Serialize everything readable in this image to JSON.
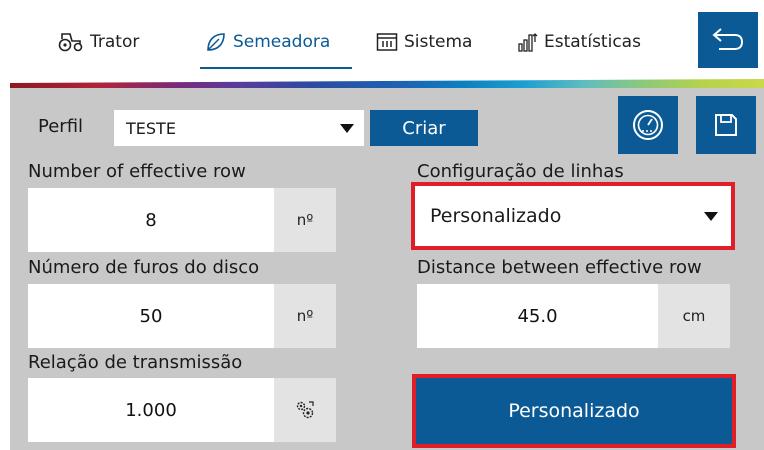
{
  "nav": {
    "tabs": [
      {
        "label": "Trator",
        "icon": "tractor-icon"
      },
      {
        "label": "Semeadora",
        "icon": "leaf-icon",
        "active": true
      },
      {
        "label": "Sistema",
        "icon": "calendar-icon"
      },
      {
        "label": "Estatísticas",
        "icon": "stats-icon"
      }
    ],
    "back_icon": "back-arrow-icon"
  },
  "profile": {
    "label": "Perfil",
    "selected": "TESTE",
    "create_label": "Criar"
  },
  "row_count": {
    "label": "Number of effective row",
    "value": "8",
    "unit": "nº"
  },
  "disc_holes": {
    "label": "Número de furos do disco",
    "value": "50",
    "unit": "nº"
  },
  "transmission": {
    "label": "Relação de transmissão",
    "value": "1.000",
    "unit_icon": "gears-icon"
  },
  "line_config": {
    "label": "Configuração de linhas",
    "selected": "Personalizado"
  },
  "row_distance": {
    "label": "Distance between effective row",
    "value": "45.0",
    "unit": "cm"
  },
  "custom_button": {
    "label": "Personalizado"
  },
  "colors": {
    "accent": "#0b5a96",
    "panel": "#c8c8c8",
    "highlight": "#e01e26",
    "unit_bg": "#e3e3e3"
  }
}
